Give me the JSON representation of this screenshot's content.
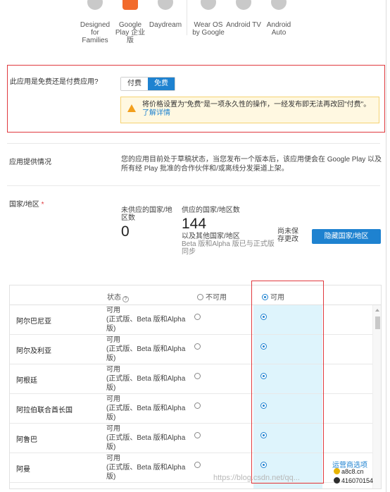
{
  "programs": [
    {
      "label": "Designed for Families",
      "icon": "families-icon",
      "active": false
    },
    {
      "label": "Google Play 企业版",
      "icon": "play-enterprise-icon",
      "active": true
    },
    {
      "label": "Daydream",
      "icon": "daydream-icon",
      "active": false
    },
    {
      "label": "Wear OS by Google",
      "icon": "wear-os-icon",
      "active": false
    },
    {
      "label": "Android TV",
      "icon": "android-tv-icon",
      "active": false
    },
    {
      "label": "Android Auto",
      "icon": "android-auto-icon",
      "active": false
    }
  ],
  "pricing": {
    "question": "此应用是免费还是付费应用?",
    "paid_label": "付费",
    "free_label": "免费",
    "warning_text": "将价格设置为\"免费\"是一项永久性的操作，一经发布即无法再改回\"付费\"。",
    "warning_link": "了解详情"
  },
  "availability": {
    "label": "应用提供情况",
    "text": "您的应用目前处于草稿状态，当您发布一个版本后，该应用便会在 Google Play 以及所有经 Play 批准的合作伙伴和/或离线分发渠道上架。"
  },
  "countries": {
    "label": "国家/地区",
    "required_mark": "*",
    "unavailable_title": "未供应的国家/地区数",
    "unavailable_count": "0",
    "available_title": "供应的国家/地区数",
    "available_count": "144",
    "available_note": "以及其他国家/地区",
    "available_sub": "Beta 版和Alpha 版已与正式版同步",
    "unsaved": "尚未保存更改",
    "hide_button": "隐藏国家/地区"
  },
  "table": {
    "status_header": "状态",
    "unavailable_header": "不可用",
    "available_header": "可用",
    "rows": [
      {
        "country": "阿尔巴尼亚",
        "status": "可用\n(正式版、Beta 版和Alpha 版)",
        "available": true
      },
      {
        "country": "阿尔及利亚",
        "status": "可用\n(正式版、Beta 版和Alpha 版)",
        "available": true
      },
      {
        "country": "阿根廷",
        "status": "可用\n(正式版、Beta 版和Alpha 版)",
        "available": true
      },
      {
        "country": "阿拉伯联合酋长国",
        "status": "可用\n(正式版、Beta 版和Alpha 版)",
        "available": true
      },
      {
        "country": "阿鲁巴",
        "status": "可用\n(正式版、Beta 版和Alpha 版)",
        "available": true
      },
      {
        "country": "阿曼",
        "status": "可用\n(正式版、Beta 版和Alpha 版)",
        "available": true
      }
    ]
  },
  "carrier_options": "运营商选项",
  "watermarks": {
    "site": "a8c8.cn",
    "qq": "416070154",
    "csdn": "https://blog.csdn.net/qq..."
  },
  "colors": {
    "accent": "#1e82d0",
    "highlight": "#e0393e",
    "available_column": "#def4fc",
    "warning_bg": "#fff8e1"
  }
}
